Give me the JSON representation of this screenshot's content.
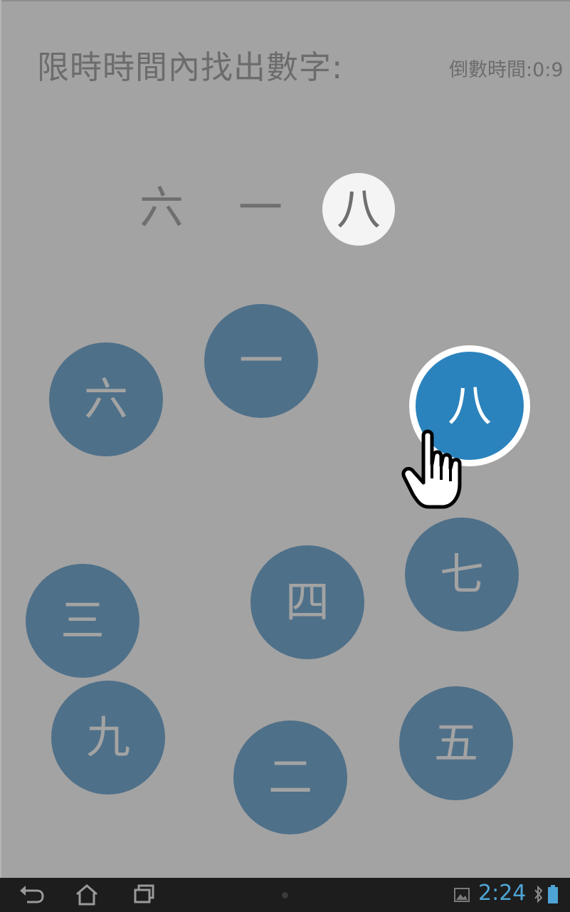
{
  "header": {
    "title": "限時時間內找出數字:",
    "timer": "倒數時間:0:9"
  },
  "sequence": [
    {
      "label": "六",
      "current": false
    },
    {
      "label": "一",
      "current": false
    },
    {
      "label": "八",
      "current": true
    }
  ],
  "bubbles": [
    {
      "label": "一",
      "highlighted": false
    },
    {
      "label": "六",
      "highlighted": false
    },
    {
      "label": "八",
      "highlighted": true
    },
    {
      "label": "七",
      "highlighted": false
    },
    {
      "label": "四",
      "highlighted": false
    },
    {
      "label": "三",
      "highlighted": false
    },
    {
      "label": "九",
      "highlighted": false
    },
    {
      "label": "五",
      "highlighted": false
    },
    {
      "label": "二",
      "highlighted": false
    }
  ],
  "colors": {
    "background": "#a3a3a3",
    "bubble": "#4f7089",
    "bubble_highlight": "#2b83bd",
    "clock": "#4ea5d5"
  },
  "navbar": {
    "back_icon": "back-icon",
    "home_icon": "home-icon",
    "recents_icon": "recent-apps-icon",
    "clock": "2:24"
  }
}
